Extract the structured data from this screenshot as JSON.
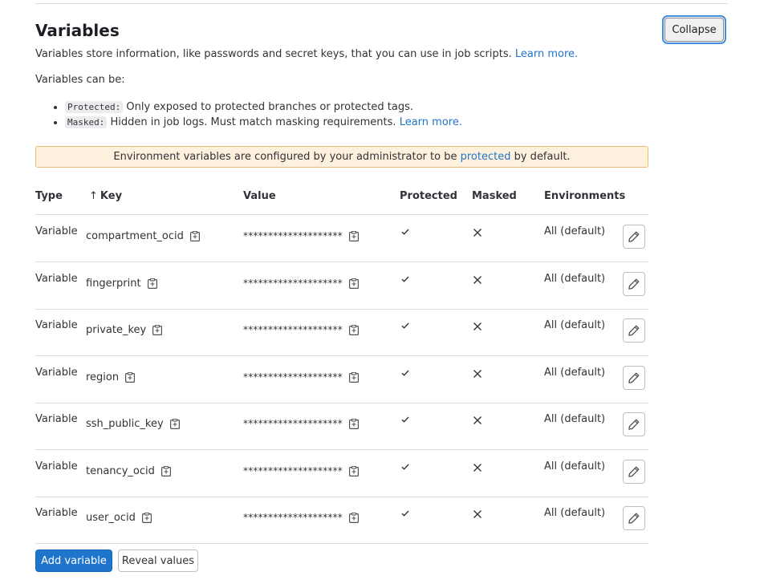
{
  "section": {
    "title": "Variables",
    "collapse_label": "Collapse",
    "intro_text": "Variables store information, like passwords and secret keys, that you can use in job scripts.",
    "intro_link": "Learn more.",
    "can_be_text": "Variables can be:",
    "options": [
      {
        "tag": "Protected:",
        "text": "Only exposed to protected branches or protected tags.",
        "link": ""
      },
      {
        "tag": "Masked:",
        "text": "Hidden in job logs. Must match masking requirements.",
        "link": "Learn more."
      }
    ],
    "alert": {
      "before": "Environment variables are configured by your administrator to be",
      "link": "protected",
      "after": "by default."
    }
  },
  "table": {
    "headers": {
      "type": "Type",
      "key": "Key",
      "value": "Value",
      "protected": "Protected",
      "masked": "Masked",
      "environments": "Environments"
    },
    "sort_icon": "arrow-up-icon",
    "rows": [
      {
        "type": "Variable",
        "key": "compartment_ocid",
        "value": "********************",
        "protected": true,
        "masked": false,
        "environment": "All (default)"
      },
      {
        "type": "Variable",
        "key": "fingerprint",
        "value": "********************",
        "protected": true,
        "masked": false,
        "environment": "All (default)"
      },
      {
        "type": "Variable",
        "key": "private_key",
        "value": "********************",
        "protected": true,
        "masked": false,
        "environment": "All (default)"
      },
      {
        "type": "Variable",
        "key": "region",
        "value": "********************",
        "protected": true,
        "masked": false,
        "environment": "All (default)"
      },
      {
        "type": "Variable",
        "key": "ssh_public_key",
        "value": "********************",
        "protected": true,
        "masked": false,
        "environment": "All (default)"
      },
      {
        "type": "Variable",
        "key": "tenancy_ocid",
        "value": "********************",
        "protected": true,
        "masked": false,
        "environment": "All (default)"
      },
      {
        "type": "Variable",
        "key": "user_ocid",
        "value": "********************",
        "protected": true,
        "masked": false,
        "environment": "All (default)"
      }
    ]
  },
  "actions": {
    "add_label": "Add variable",
    "reveal_label": "Reveal values"
  },
  "colors": {
    "primary": "#1f75cb",
    "alert_bg": "#fdf1dd",
    "alert_border": "#e9be74",
    "border": "#dcdcde",
    "text": "#333238"
  }
}
